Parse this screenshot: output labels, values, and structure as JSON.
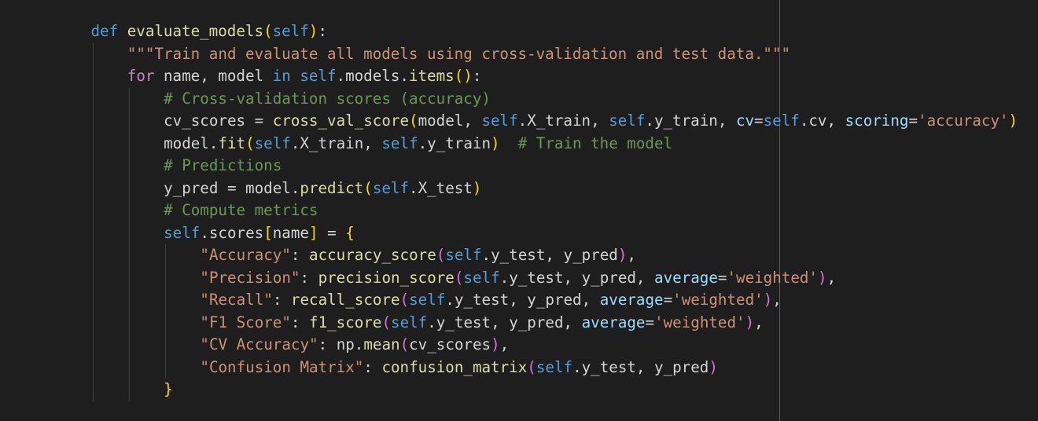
{
  "editor": {
    "language": "python",
    "lines": [
      {
        "indent": 1,
        "tokens": [
          [
            "def",
            "kw"
          ],
          [
            " ",
            "plain"
          ],
          [
            "evaluate_models",
            "fn"
          ],
          [
            "(",
            "b1"
          ],
          [
            "self",
            "self"
          ],
          [
            ")",
            "b1"
          ],
          [
            ":",
            "plain"
          ]
        ]
      },
      {
        "indent": 2,
        "tokens": [
          [
            "\"\"\"Train and evaluate all models using cross-validation and test data.\"\"\"",
            "str"
          ]
        ]
      },
      {
        "indent": 2,
        "tokens": [
          [
            "for",
            "ctrl"
          ],
          [
            " name, model ",
            "plain"
          ],
          [
            "in",
            "kw"
          ],
          [
            " ",
            "plain"
          ],
          [
            "self",
            "self"
          ],
          [
            ".models.",
            "plain"
          ],
          [
            "items",
            "fn"
          ],
          [
            "(",
            "b1"
          ],
          [
            ")",
            "b1"
          ],
          [
            ":",
            "plain"
          ]
        ]
      },
      {
        "indent": 3,
        "tokens": [
          [
            "# Cross-validation scores (accuracy)",
            "com"
          ]
        ]
      },
      {
        "indent": 3,
        "tokens": [
          [
            "cv_scores = ",
            "plain"
          ],
          [
            "cross_val_score",
            "fn"
          ],
          [
            "(",
            "b1"
          ],
          [
            "model, ",
            "plain"
          ],
          [
            "self",
            "self"
          ],
          [
            ".X_train, ",
            "plain"
          ],
          [
            "self",
            "self"
          ],
          [
            ".y_train, ",
            "plain"
          ],
          [
            "cv",
            "var"
          ],
          [
            "=",
            "plain"
          ],
          [
            "self",
            "self"
          ],
          [
            ".cv, ",
            "plain"
          ],
          [
            "scoring",
            "var"
          ],
          [
            "=",
            "plain"
          ],
          [
            "'accuracy'",
            "str"
          ],
          [
            ")",
            "b1"
          ]
        ]
      },
      {
        "indent": 3,
        "tokens": [
          [
            "model.",
            "plain"
          ],
          [
            "fit",
            "fn"
          ],
          [
            "(",
            "b1"
          ],
          [
            "self",
            "self"
          ],
          [
            ".X_train, ",
            "plain"
          ],
          [
            "self",
            "self"
          ],
          [
            ".y_train",
            "plain"
          ],
          [
            ")",
            "b1"
          ],
          [
            "  ",
            "plain"
          ],
          [
            "# Train the model",
            "com"
          ]
        ]
      },
      {
        "indent": 3,
        "tokens": [
          [
            "# Predictions",
            "com"
          ]
        ]
      },
      {
        "indent": 3,
        "tokens": [
          [
            "y_pred = model.",
            "plain"
          ],
          [
            "predict",
            "fn"
          ],
          [
            "(",
            "b1"
          ],
          [
            "self",
            "self"
          ],
          [
            ".X_test",
            "plain"
          ],
          [
            ")",
            "b1"
          ]
        ]
      },
      {
        "indent": 3,
        "tokens": [
          [
            "# Compute metrics",
            "com"
          ]
        ]
      },
      {
        "indent": 3,
        "tokens": [
          [
            "self",
            "self"
          ],
          [
            ".scores",
            "plain"
          ],
          [
            "[",
            "b1"
          ],
          [
            "name",
            "plain"
          ],
          [
            "]",
            "b1"
          ],
          [
            " = ",
            "plain"
          ],
          [
            "{",
            "b1"
          ]
        ]
      },
      {
        "indent": 4,
        "tokens": [
          [
            "\"Accuracy\"",
            "str"
          ],
          [
            ": ",
            "plain"
          ],
          [
            "accuracy_score",
            "fn"
          ],
          [
            "(",
            "b2"
          ],
          [
            "self",
            "self"
          ],
          [
            ".y_test, y_pred",
            "plain"
          ],
          [
            ")",
            "b2"
          ],
          [
            ",",
            "plain"
          ]
        ]
      },
      {
        "indent": 4,
        "tokens": [
          [
            "\"Precision\"",
            "str"
          ],
          [
            ": ",
            "plain"
          ],
          [
            "precision_score",
            "fn"
          ],
          [
            "(",
            "b2"
          ],
          [
            "self",
            "self"
          ],
          [
            ".y_test, y_pred, ",
            "plain"
          ],
          [
            "average",
            "var"
          ],
          [
            "=",
            "plain"
          ],
          [
            "'weighted'",
            "str"
          ],
          [
            ")",
            "b2"
          ],
          [
            ",",
            "plain"
          ]
        ]
      },
      {
        "indent": 4,
        "tokens": [
          [
            "\"Recall\"",
            "str"
          ],
          [
            ": ",
            "plain"
          ],
          [
            "recall_score",
            "fn"
          ],
          [
            "(",
            "b2"
          ],
          [
            "self",
            "self"
          ],
          [
            ".y_test, y_pred, ",
            "plain"
          ],
          [
            "average",
            "var"
          ],
          [
            "=",
            "plain"
          ],
          [
            "'weighted'",
            "str"
          ],
          [
            ")",
            "b2"
          ],
          [
            ",",
            "plain"
          ]
        ]
      },
      {
        "indent": 4,
        "tokens": [
          [
            "\"F1 Score\"",
            "str"
          ],
          [
            ": ",
            "plain"
          ],
          [
            "f1_score",
            "fn"
          ],
          [
            "(",
            "b2"
          ],
          [
            "self",
            "self"
          ],
          [
            ".y_test, y_pred, ",
            "plain"
          ],
          [
            "average",
            "var"
          ],
          [
            "=",
            "plain"
          ],
          [
            "'weighted'",
            "str"
          ],
          [
            ")",
            "b2"
          ],
          [
            ",",
            "plain"
          ]
        ]
      },
      {
        "indent": 4,
        "tokens": [
          [
            "\"CV Accuracy\"",
            "str"
          ],
          [
            ": ",
            "plain"
          ],
          [
            "np.",
            "plain"
          ],
          [
            "mean",
            "fn"
          ],
          [
            "(",
            "b2"
          ],
          [
            "cv_scores",
            "plain"
          ],
          [
            ")",
            "b2"
          ],
          [
            ",",
            "plain"
          ]
        ]
      },
      {
        "indent": 4,
        "tokens": [
          [
            "\"Confusion Matrix\"",
            "str"
          ],
          [
            ": ",
            "plain"
          ],
          [
            "confusion_matrix",
            "fn"
          ],
          [
            "(",
            "b2"
          ],
          [
            "self",
            "self"
          ],
          [
            ".y_test, y_pred",
            "plain"
          ],
          [
            ")",
            "b2"
          ]
        ]
      },
      {
        "indent": 3,
        "tokens": [
          [
            "}",
            "b1"
          ]
        ]
      }
    ]
  },
  "colors": {
    "background": "#1e1e1e",
    "plain": "#d4d4d4",
    "keyword": "#569cd6",
    "control": "#c586c0",
    "function": "#dcdcaa",
    "string": "#ce9178",
    "comment": "#6a9955",
    "bracket_level_1": "#ffd700",
    "bracket_level_2": "#da70d6",
    "ruler": "#5a5a5a"
  }
}
